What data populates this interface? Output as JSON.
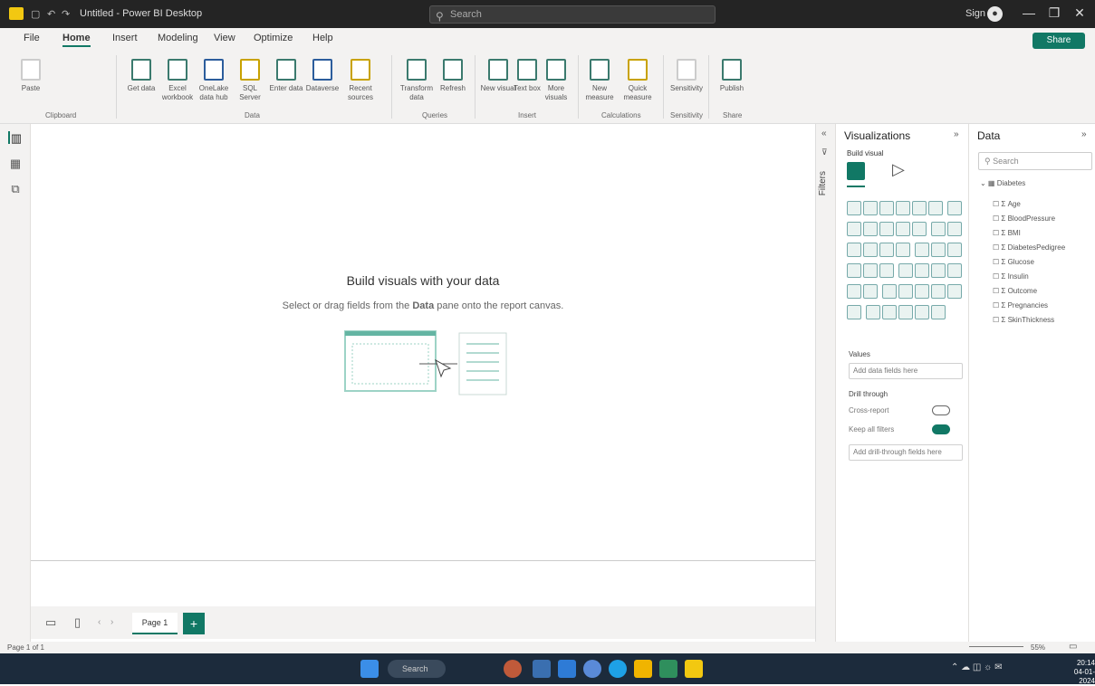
{
  "titlebar": {
    "title": "Untitled - Power BI Desktop",
    "search_placeholder": "Search",
    "user": "Sign in"
  },
  "menu": {
    "tabs": [
      "File",
      "Home",
      "Insert",
      "Modeling",
      "View",
      "Optimize",
      "Help"
    ],
    "share": "Share"
  },
  "ribbon": {
    "buttons": [
      "Paste",
      "Get data",
      "Excel workbook",
      "OneLake data hub",
      "SQL Server",
      "Enter data",
      "Dataverse",
      "Recent sources",
      "Transform data",
      "Refresh",
      "New visual",
      "Text box",
      "More visuals",
      "New measure",
      "Quick measure",
      "Sensitivity",
      "Publish"
    ],
    "groups": [
      "Clipboard",
      "Data",
      "Queries",
      "Insert",
      "Calculations",
      "Sensitivity",
      "Share"
    ]
  },
  "canvas": {
    "empty_title": "Build visuals with your data",
    "empty_sub_prefix": "Select or drag fields from the ",
    "empty_sub_bold": "Data",
    "empty_sub_suffix": " pane onto the report canvas."
  },
  "pages": {
    "tab": "Page 1",
    "add": "+"
  },
  "status": {
    "page_info": "Page 1 of 1",
    "zoom": "55%"
  },
  "filters": {
    "label": "Filters"
  },
  "viz": {
    "title": "Visualizations",
    "build_visual": "Build visual",
    "values_label": "Values",
    "values_placeholder": "Add data fields here",
    "drill_label": "Drill through",
    "cross_report": "Cross-report",
    "keep_filters": "Keep all filters",
    "drill_placeholder": "Add drill-through fields here",
    "cross_report_state": "Off",
    "keep_filters_state": "On"
  },
  "data": {
    "title": "Data",
    "search_placeholder": "Search",
    "table": "Diabetes",
    "fields": [
      "Age",
      "BloodPressure",
      "BMI",
      "DiabetesPedigree",
      "Glucose",
      "Insulin",
      "Outcome",
      "Pregnancies",
      "SkinThickness"
    ]
  },
  "taskbar": {
    "search": "Search",
    "time": "20:14",
    "date": "04-01-2024"
  }
}
